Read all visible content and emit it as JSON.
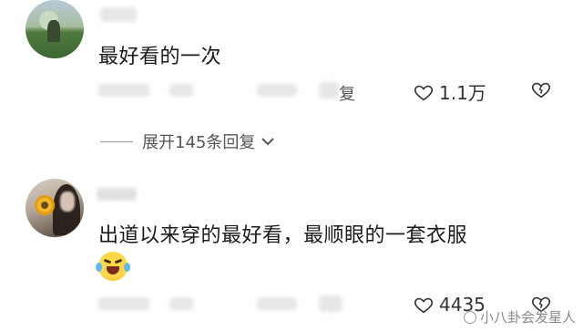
{
  "comments": [
    {
      "text": "最好看的一次",
      "reply_suffix": "复",
      "likes": "1.1万"
    },
    {
      "text": "出道以来穿的最好看，最顺眼的一套衣服",
      "likes": "4435"
    }
  ],
  "expand_replies": "展开145条回复",
  "watermark": "小八卦会发星人",
  "icons": {
    "like": "heart-outline-icon",
    "dislike": "broken-heart-icon",
    "expand": "chevron-down-icon",
    "emoji": "laughing-crying-emoji"
  },
  "colors": {
    "text": "#1a1a1a",
    "muted": "#555555",
    "background": "#ffffff"
  }
}
